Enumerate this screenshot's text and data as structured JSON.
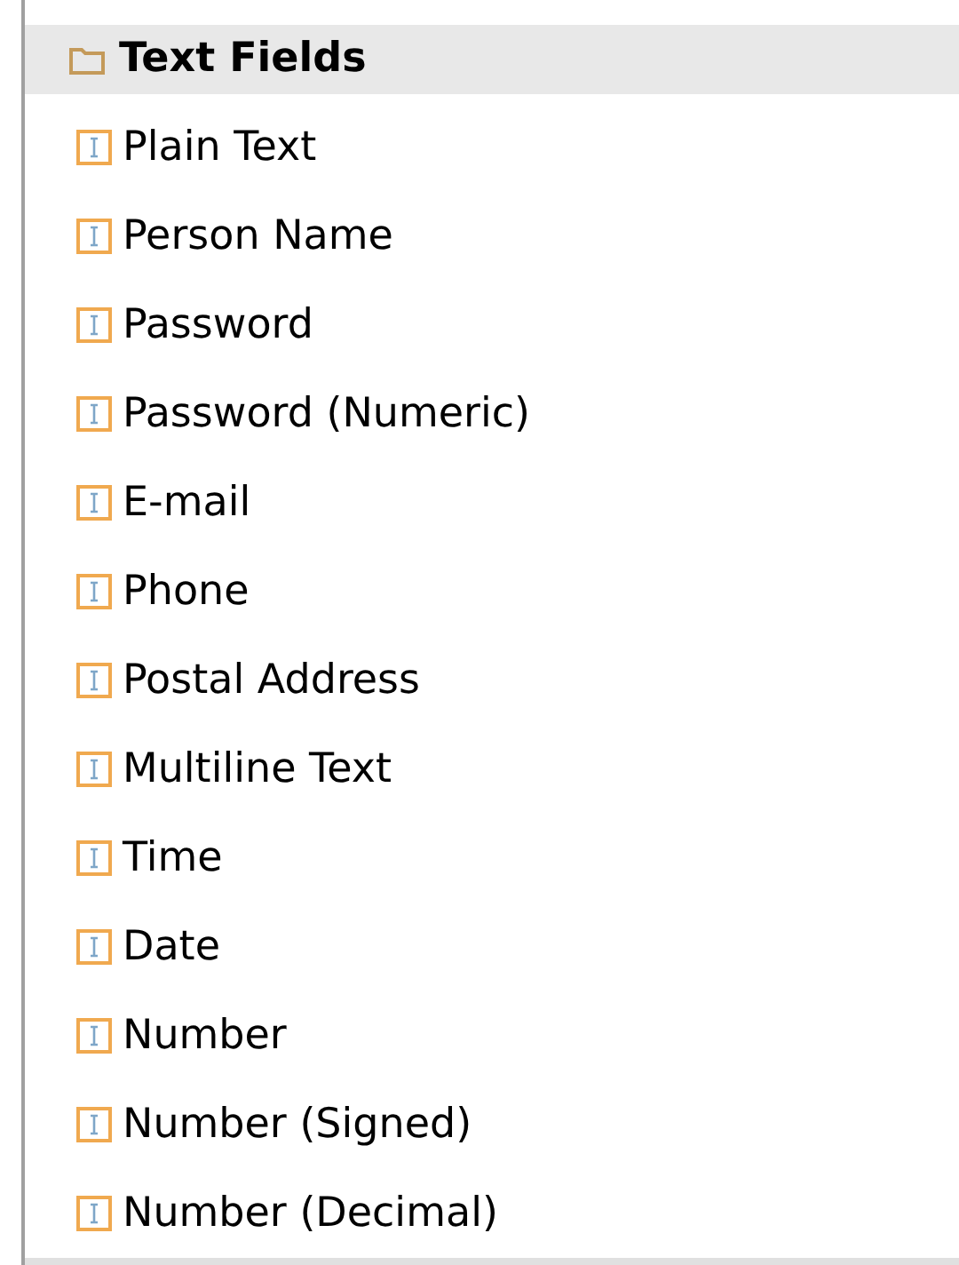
{
  "palette": {
    "category": "Text Fields",
    "items": [
      {
        "label": "Plain Text"
      },
      {
        "label": "Person Name"
      },
      {
        "label": "Password"
      },
      {
        "label": "Password (Numeric)"
      },
      {
        "label": "E-mail"
      },
      {
        "label": "Phone"
      },
      {
        "label": "Postal Address"
      },
      {
        "label": "Multiline Text"
      },
      {
        "label": "Time"
      },
      {
        "label": "Date"
      },
      {
        "label": "Number"
      },
      {
        "label": "Number (Signed)"
      },
      {
        "label": "Number (Decimal)"
      }
    ]
  }
}
